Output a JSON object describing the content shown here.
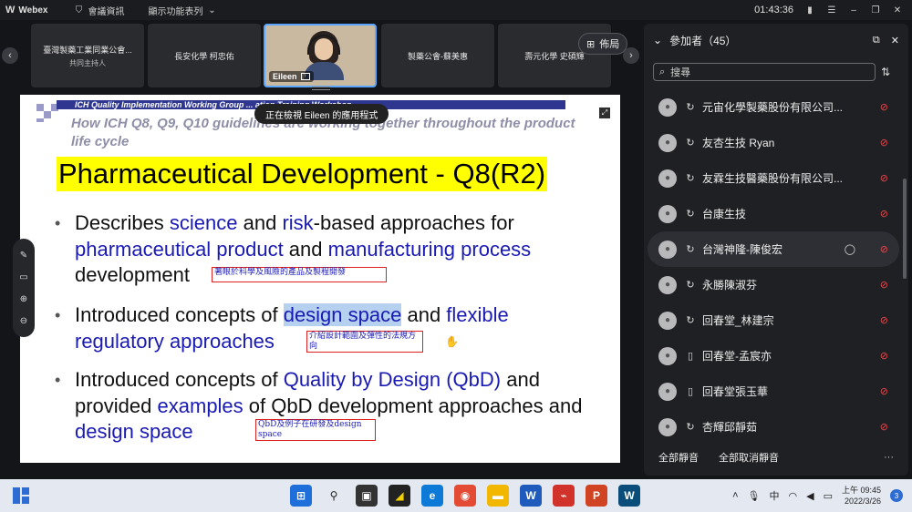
{
  "topbar": {
    "app_name": "Webex",
    "meeting_info": "會議資訊",
    "view_menu": "顯示功能表列",
    "clock": "01:43:36"
  },
  "filmstrip": {
    "tiles": [
      {
        "name": "臺灣製藥工業同業公會...",
        "role": "共同主持人"
      },
      {
        "name": "長安化學 柯忠佑"
      },
      {
        "name": "Eileen"
      },
      {
        "name": "製藥公會-蘇美惠"
      },
      {
        "name": "壽元化學 史碩輝"
      }
    ],
    "layout_label": "佈局"
  },
  "share_banner": "正在檢視 Eileen 的應用程式",
  "slide": {
    "header_band": "ICH Quality Implementation Working Group ... ation Training Workshop",
    "subtitle": "How ICH Q8, Q9, Q10 guidelines are working together throughout the product life cycle",
    "title": "Pharmaceutical Development - Q8(R2)",
    "bullet1": {
      "t1": "Describes ",
      "h1": "science",
      "t2": " and ",
      "h2": "risk",
      "t3": "-based approaches for ",
      "h3": "pharmaceutical product",
      "t4": " and ",
      "h4": "manufacturing process",
      "t5": " development"
    },
    "bullet2": {
      "t1": "Introduced concepts of ",
      "h1": "design space",
      "t2": " and ",
      "h2": "flexible regulatory approaches"
    },
    "bullet3": {
      "t1": "Introduced concepts of ",
      "h1": "Quality by Design (QbD)",
      "t2": " and provided ",
      "h2": "examples",
      "t3": " of QbD development approaches and ",
      "h3": "design space"
    },
    "note1": "著眼於科學及風險的產品及製程開發",
    "note2": "介紹設計範圍及彈性的法規方向",
    "note3": "QbD及例子在研發及design space"
  },
  "participants": {
    "title": "參加者（45）",
    "search_placeholder": "搜尋",
    "items": [
      {
        "name": "元宙化學製藥股份有限公司...",
        "conn": "audio"
      },
      {
        "name": "友杏生技 Ryan",
        "conn": "audio"
      },
      {
        "name": "友霖生技醫藥股份有限公司...",
        "conn": "audio"
      },
      {
        "name": "台康生技",
        "conn": "audio"
      },
      {
        "name": "台灣神隆-陳俊宏",
        "conn": "audio"
      },
      {
        "name": "永勝陳淑芬",
        "conn": "audio"
      },
      {
        "name": "回春堂_林建宗",
        "conn": "audio"
      },
      {
        "name": "回春堂-孟宸亦",
        "conn": "phone"
      },
      {
        "name": "回春堂張玉華",
        "conn": "phone"
      },
      {
        "name": "杏輝邱靜茹",
        "conn": "audio"
      }
    ],
    "mute_all": "全部靜音",
    "unmute_all": "全部取消靜音"
  },
  "taskbar": {
    "ime": "中",
    "time": "上午 09:45",
    "date": "2022/3/26",
    "notifications": "3"
  },
  "colors": {
    "accent": "#5aa5ff",
    "muted": "#e5484d",
    "slide_title_bg": "#ffff00",
    "slide_highlight": "#1a1ab4"
  }
}
